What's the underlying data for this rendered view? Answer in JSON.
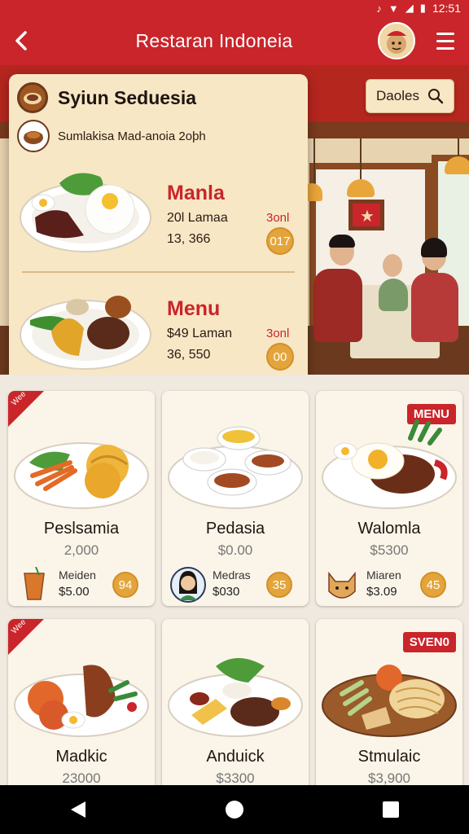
{
  "status_bar": {
    "time": "12:51"
  },
  "app_bar": {
    "title": "Restaran Indoneia"
  },
  "search_chip": {
    "label": "Daoles"
  },
  "popup": {
    "title": "Syiun Seduesia",
    "subtitle": "Sumlakisa  Mad-anoia 2oþh",
    "items": [
      {
        "name": "Manla",
        "line1": "20l Lamaa",
        "line2": "13, 366",
        "qty": "3onl",
        "badge": "017"
      },
      {
        "name": "Menu",
        "line1": "$49 Laman",
        "line2": "36, 550",
        "qty": "3onl",
        "badge": "00"
      }
    ]
  },
  "cards": [
    {
      "ribbon": "Wee",
      "tag": "",
      "name": "Peslsamia",
      "price": "2,000",
      "foot_label": "Meiden",
      "foot_price": "$5.00",
      "badge": "94",
      "foot_icon": "iced-tea-icon"
    },
    {
      "ribbon": "",
      "tag": "",
      "name": "Pedasia",
      "price": "$0.00",
      "foot_label": "Medras",
      "foot_price": "$030",
      "badge": "35",
      "foot_icon": "person-avatar-icon"
    },
    {
      "ribbon": "",
      "tag": "MENU",
      "name": "Walomla",
      "price": "$5300",
      "foot_label": "Miaren",
      "foot_price": "$3.09",
      "badge": "45",
      "foot_icon": "cat-mascot-icon"
    },
    {
      "ribbon": "Wee",
      "tag": "",
      "name": "Madkic",
      "price": "23000"
    },
    {
      "ribbon": "",
      "tag": "",
      "name": "Anduick",
      "price": "$3300"
    },
    {
      "ribbon": "",
      "tag": "SVEN0",
      "name": "Stmulaic",
      "price": "$3,900"
    }
  ],
  "colors": {
    "brand_red": "#c9252a",
    "accent_gold": "#e3a53b",
    "cream": "#f8e7c5"
  }
}
